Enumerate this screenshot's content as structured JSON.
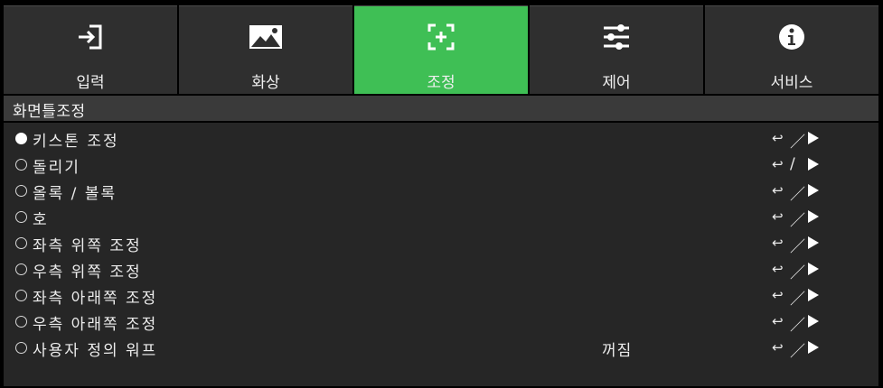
{
  "tabs": [
    {
      "label": "입력",
      "icon": "input-icon",
      "active": false
    },
    {
      "label": "화상",
      "icon": "image-icon",
      "active": false
    },
    {
      "label": "조정",
      "icon": "adjust-icon",
      "active": true
    },
    {
      "label": "제어",
      "icon": "sliders-icon",
      "active": false
    },
    {
      "label": "서비스",
      "icon": "info-icon",
      "active": false
    }
  ],
  "section": {
    "title": "화면틀조정"
  },
  "items": [
    {
      "label": "키스톤 조정",
      "value": "",
      "selected": true,
      "action_separator": "／"
    },
    {
      "label": "돌리기",
      "value": "",
      "selected": false,
      "action_separator": "/"
    },
    {
      "label": "올록 / 볼록",
      "value": "",
      "selected": false,
      "action_separator": "／"
    },
    {
      "label": "호",
      "value": "",
      "selected": false,
      "action_separator": "／"
    },
    {
      "label": "좌측 위쪽 조정",
      "value": "",
      "selected": false,
      "action_separator": "／"
    },
    {
      "label": "우측 위쪽 조정",
      "value": "",
      "selected": false,
      "action_separator": "／"
    },
    {
      "label": "좌측 아래쪽 조정",
      "value": "",
      "selected": false,
      "action_separator": "／"
    },
    {
      "label": "우측 아래쪽 조정",
      "value": "",
      "selected": false,
      "action_separator": "／"
    },
    {
      "label": "사용자 정의 워프",
      "value": "꺼짐",
      "selected": false,
      "action_separator": "／"
    }
  ],
  "action": {
    "return_symbol": "↩",
    "arrow_icon": "play-arrow-icon"
  },
  "colors": {
    "active_tab": "#3fbf55",
    "tab_bg": "#2f2f2f",
    "section_bg": "#3a3a3a",
    "list_bg": "#262626"
  }
}
